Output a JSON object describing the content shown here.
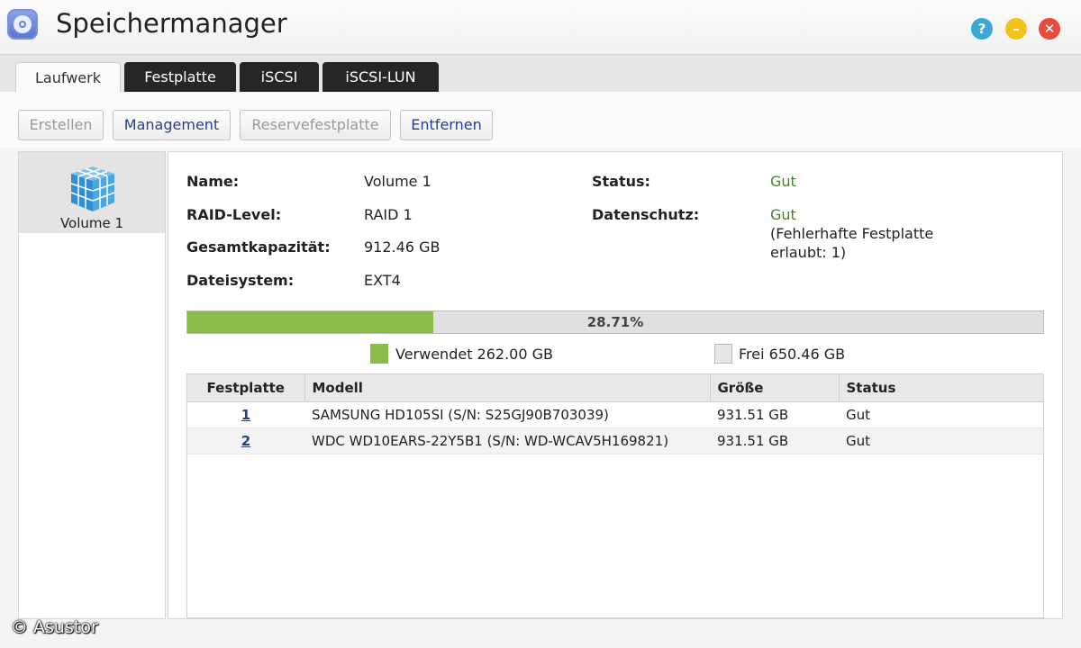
{
  "window": {
    "title": "Speichermanager"
  },
  "window_controls": {
    "help": "?",
    "minimize": "–",
    "close": "✕"
  },
  "tabs": [
    {
      "label": "Laufwerk",
      "active": true
    },
    {
      "label": "Festplatte",
      "active": false
    },
    {
      "label": "iSCSI",
      "active": false
    },
    {
      "label": "iSCSI-LUN",
      "active": false
    }
  ],
  "toolbar": {
    "create": "Erstellen",
    "management": "Management",
    "spare": "Reservefestplatte",
    "remove": "Entfernen"
  },
  "volumes": [
    {
      "label": "Volume 1"
    }
  ],
  "details": {
    "name_label": "Name:",
    "name_value": "Volume 1",
    "raid_label": "RAID-Level:",
    "raid_value": "RAID 1",
    "capacity_label": "Gesamtkapazität:",
    "capacity_value": "912.46 GB",
    "fs_label": "Dateisystem:",
    "fs_value": "EXT4",
    "status_label": "Status:",
    "status_value": "Gut",
    "protection_label": "Datenschutz:",
    "protection_value": "Gut",
    "protection_note_1": "(Fehlerhafte Festplatte",
    "protection_note_2": "erlaubt: 1)"
  },
  "usage": {
    "percent": 28.71,
    "percent_text": "28.71%",
    "used_text": "Verwendet 262.00 GB",
    "free_text": "Frei 650.46 GB",
    "used_color": "#8dbb4c",
    "free_color": "#e6e6e6"
  },
  "disks": {
    "headers": [
      "Festplatte",
      "Modell",
      "Größe",
      "Status"
    ],
    "rows": [
      {
        "id": "1",
        "model": "SAMSUNG HD105SI (S/N: S25GJ90B703039)",
        "size": "931.51 GB",
        "status": "Gut"
      },
      {
        "id": "2",
        "model": "WDC WD10EARS-22Y5B1 (S/N: WD-WCAV5H169821)",
        "size": "931.51 GB",
        "status": "Gut"
      }
    ]
  },
  "watermark": "© Asustor",
  "colors": {
    "status_good": "#3d8a1a",
    "link": "#25418e"
  }
}
